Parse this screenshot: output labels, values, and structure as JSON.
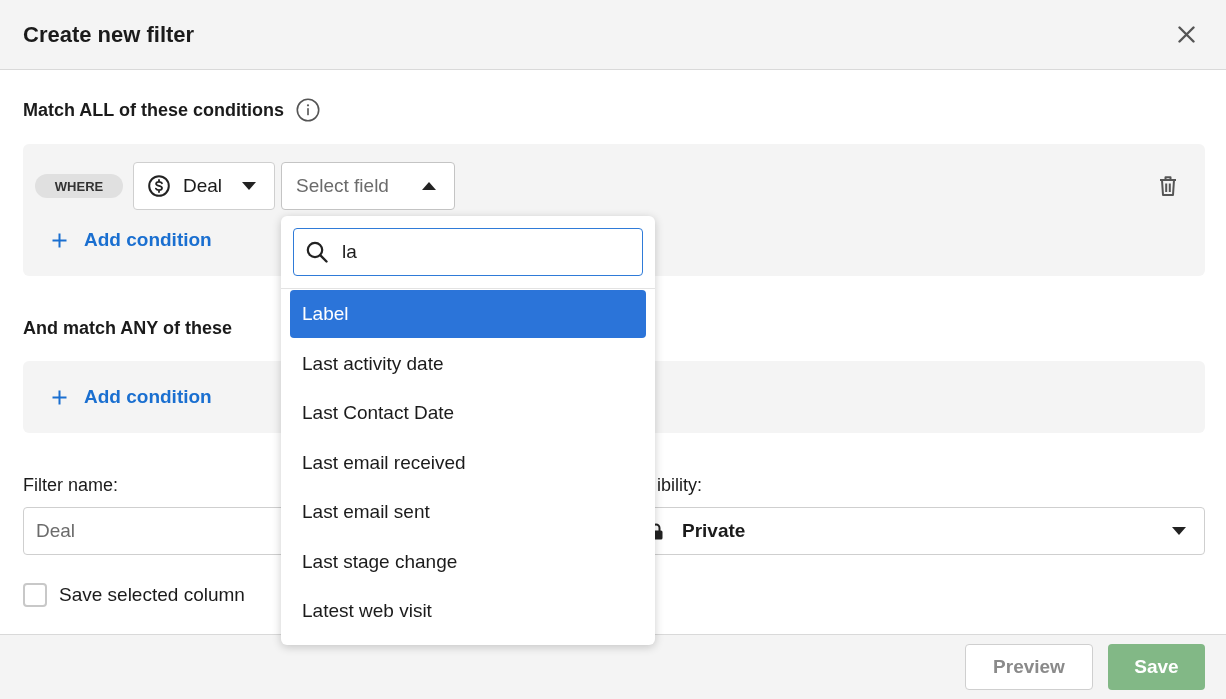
{
  "dialog": {
    "title": "Create new filter"
  },
  "all_conditions": {
    "heading": "Match ALL of these conditions",
    "rows": [
      {
        "badge": "WHERE",
        "entity": "Deal",
        "field": {
          "placeholder": "Select field",
          "expanded": true
        }
      }
    ],
    "add_label": "Add condition"
  },
  "field_dropdown": {
    "search": {
      "value": "la"
    },
    "options": [
      {
        "label": "Label",
        "selected": true
      },
      {
        "label": "Last activity date",
        "selected": false
      },
      {
        "label": "Last Contact Date",
        "selected": false
      },
      {
        "label": "Last email received",
        "selected": false
      },
      {
        "label": "Last email sent",
        "selected": false
      },
      {
        "label": "Last stage change",
        "selected": false
      },
      {
        "label": "Latest web visit",
        "selected": false
      }
    ]
  },
  "any_conditions": {
    "heading": "And match ANY of these",
    "add_label": "Add condition"
  },
  "filter_name": {
    "label": "Filter name:",
    "placeholder": "Deal"
  },
  "visibility": {
    "label": "ibility:",
    "value": "Private"
  },
  "save_columns": {
    "label": "Save selected column",
    "checked": false
  },
  "buttons": [
    {
      "label": "Preview",
      "kind": "secondary",
      "disabled": true
    },
    {
      "label": "Save",
      "kind": "primary",
      "disabled": true
    }
  ]
}
